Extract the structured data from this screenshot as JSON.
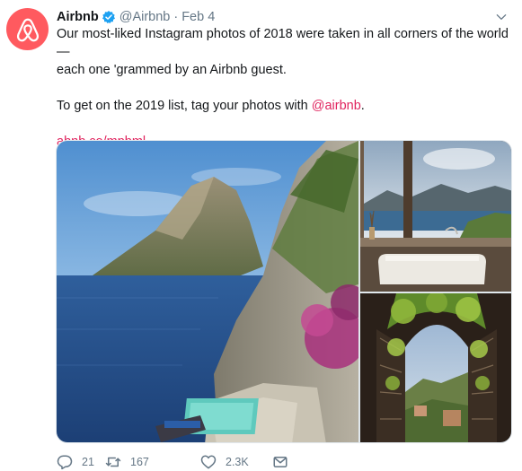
{
  "tweet": {
    "author_name": "Airbnb",
    "handle": "@Airbnb",
    "separator": "·",
    "date": "Feb 4",
    "line1": "Our most-liked Instagram photos of 2018 were taken in all corners of the world—",
    "line2": "each one 'grammed by an Airbnb guest.",
    "line3_prefix": "To get on the 2019 list, tag your photos with ",
    "mention": "@airbnb",
    "line3_suffix": ".",
    "link": "abnb.co/mpbml"
  },
  "actions": {
    "replies": "21",
    "retweets": "167",
    "likes": "2.3K"
  },
  "colors": {
    "brand": "#ff5a5f",
    "link": "#e0245e",
    "verified": "#1da1f2",
    "secondary_text": "#657786"
  },
  "icons": {
    "avatar": "airbnb-logo-icon",
    "verified": "verified-badge-icon",
    "menu": "chevron-down-icon",
    "reply": "reply-icon",
    "retweet": "retweet-icon",
    "like": "heart-icon",
    "dm": "envelope-icon"
  }
}
